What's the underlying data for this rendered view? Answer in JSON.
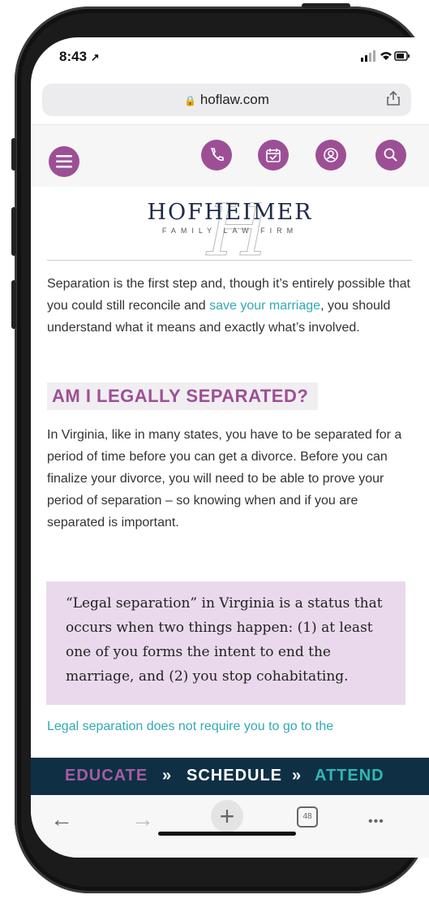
{
  "status": {
    "time": "8:43",
    "location_arrow": "↗",
    "icons": "signal wifi battery"
  },
  "browser": {
    "url": "hoflaw.com",
    "lock": "🔒",
    "share_icon": "share-icon",
    "tab_count": "48"
  },
  "nav_icons": [
    "menu-icon",
    "phone-icon",
    "calendar-icon",
    "account-icon",
    "search-icon"
  ],
  "logo": {
    "main": "HOFHEIMER",
    "sub": "FAMILY LAW FIRM",
    "monogram": "H"
  },
  "intro": {
    "before": "Separation is the first step and, though it’s entirely possible that you could still reconcile and ",
    "link": "save your marriage",
    "after": ", you should understand what it means and exactly what’s involved."
  },
  "heading": "AM I LEGALLY SEPARATED?",
  "paragraph2": "In Virginia, like in many states, you have to be separated for a period of time before you can get a divorce. Before you can finalize your divorce, you will need to be able to prove your period of separation – so knowing when and if you are separated is important.",
  "quote": "“Legal separation” in Virginia is a status that occurs when two things happen: (1) at least one of you forms the intent to end the marriage, and (2) you stop cohabitating.",
  "paragraph3": "Legal separation does not require you to go to the",
  "banner": {
    "educate": "EDUCATE",
    "sep1": "»",
    "schedule": "SCHEDULE",
    "sep2": "»",
    "attend": "ATTEND"
  },
  "toolbar": {
    "back": "←",
    "forward": "→",
    "new_tab": "+",
    "more": "•••"
  },
  "colors": {
    "brand_purple": "#9d4f96",
    "link_teal": "#30a9b5",
    "banner_navy": "#0f2f45",
    "quote_bg": "#ead9ec"
  }
}
